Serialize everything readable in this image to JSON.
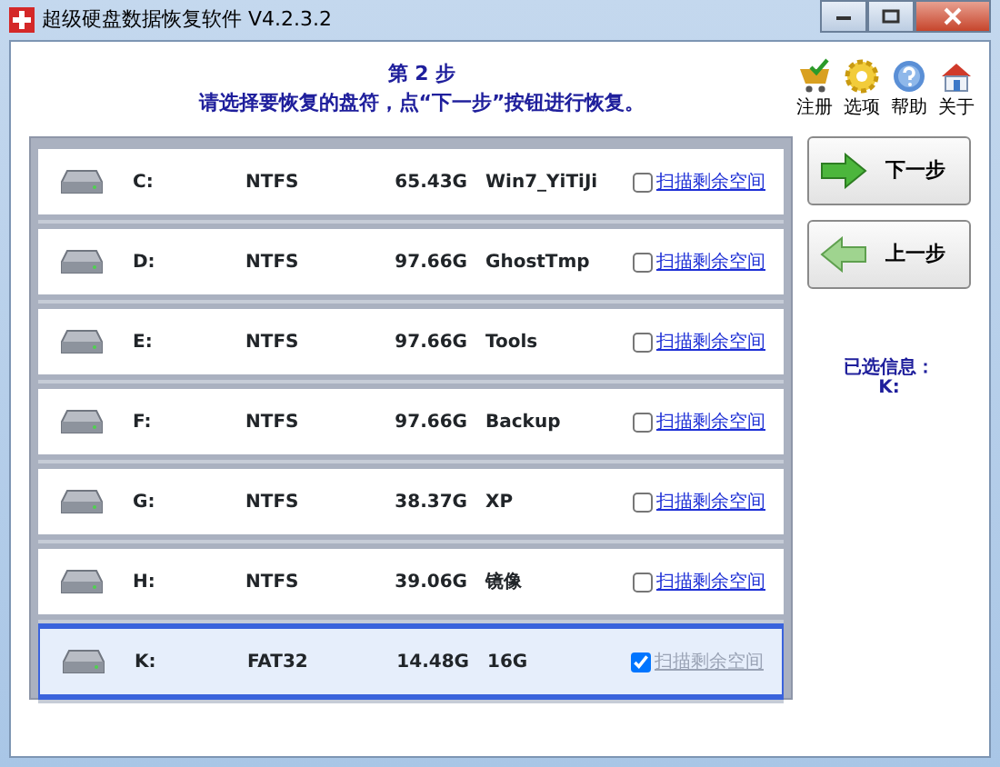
{
  "window": {
    "title": "超级硬盘数据恢复软件 V4.2.3.2"
  },
  "header": {
    "step": "第 2 步",
    "instruction": "请选择要恢复的盘符，点“下一步”按钮进行恢复。"
  },
  "toolbar": [
    {
      "label": "注册",
      "kind": "cart"
    },
    {
      "label": "选项",
      "kind": "gear"
    },
    {
      "label": "帮助",
      "kind": "help"
    },
    {
      "label": "关于",
      "kind": "home"
    }
  ],
  "drives": [
    {
      "letter": "C:",
      "fs": "NTFS",
      "size": "65.43G",
      "name": "Win7_YiTiJi",
      "link": "扫描剩余空间",
      "checked": false,
      "selected": false
    },
    {
      "letter": "D:",
      "fs": "NTFS",
      "size": "97.66G",
      "name": "GhostTmp",
      "link": "扫描剩余空间",
      "checked": false,
      "selected": false
    },
    {
      "letter": "E:",
      "fs": "NTFS",
      "size": "97.66G",
      "name": "Tools",
      "link": "扫描剩余空间",
      "checked": false,
      "selected": false
    },
    {
      "letter": "F:",
      "fs": "NTFS",
      "size": "97.66G",
      "name": "Backup",
      "link": "扫描剩余空间",
      "checked": false,
      "selected": false
    },
    {
      "letter": "G:",
      "fs": "NTFS",
      "size": "38.37G",
      "name": "XP",
      "link": "扫描剩余空间",
      "checked": false,
      "selected": false
    },
    {
      "letter": "H:",
      "fs": "NTFS",
      "size": "39.06G",
      "name": "镜像",
      "link": "扫描剩余空间",
      "checked": false,
      "selected": false
    },
    {
      "letter": "K:",
      "fs": "FAT32",
      "size": "14.48G",
      "name": "16G",
      "link": "扫描剩余空间",
      "checked": true,
      "selected": true
    }
  ],
  "buttons": [
    {
      "label": "下一步",
      "kind": "next"
    },
    {
      "label": "上一步",
      "kind": "back"
    }
  ],
  "info": {
    "title": "已选信息：",
    "value": "K:"
  }
}
